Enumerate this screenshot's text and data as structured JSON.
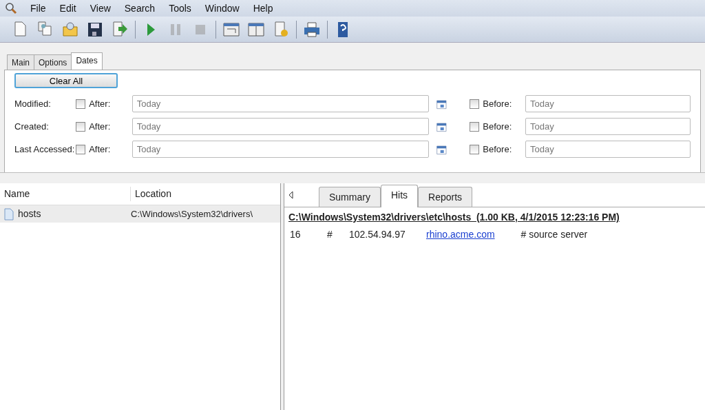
{
  "menu": [
    "File",
    "Edit",
    "View",
    "Search",
    "Tools",
    "Window",
    "Help"
  ],
  "toolbar": [
    [
      {
        "kind": "new",
        "disabled": false
      },
      {
        "kind": "copy",
        "disabled": false
      },
      {
        "kind": "open",
        "disabled": false
      },
      {
        "kind": "save",
        "disabled": false
      },
      {
        "kind": "export",
        "disabled": false
      }
    ],
    [
      {
        "kind": "play",
        "disabled": false
      },
      {
        "kind": "pause",
        "disabled": true
      },
      {
        "kind": "stop",
        "disabled": true
      }
    ],
    [
      {
        "kind": "window",
        "disabled": false
      },
      {
        "kind": "layout",
        "disabled": false
      },
      {
        "kind": "report",
        "disabled": false
      }
    ],
    [
      {
        "kind": "print",
        "disabled": false
      }
    ],
    [
      {
        "kind": "help",
        "disabled": false
      }
    ]
  ],
  "search_tabs": [
    {
      "label": "Main",
      "selected": false
    },
    {
      "label": "Options",
      "selected": false
    },
    {
      "label": "Dates",
      "selected": true
    }
  ],
  "clear_button": "Clear All",
  "date_rows": [
    {
      "label": "Modified:",
      "after": {
        "label": "After:",
        "checked": false,
        "value": "Today",
        "disabled": true
      },
      "before": {
        "label": "Before:",
        "checked": false,
        "value": "Today",
        "disabled": true
      }
    },
    {
      "label": "Created:",
      "after": {
        "label": "After:",
        "checked": false,
        "value": "Today",
        "disabled": true
      },
      "before": {
        "label": "Before:",
        "checked": false,
        "value": "Today",
        "disabled": true
      }
    },
    {
      "label": "Last Accessed:",
      "after": {
        "label": "After:",
        "checked": false,
        "value": "Today",
        "disabled": true
      },
      "before": {
        "label": "Before:",
        "checked": false,
        "value": "Today",
        "disabled": true
      }
    }
  ],
  "file_list": {
    "columns": [
      "Name",
      "Location"
    ],
    "rows": [
      {
        "name": "hosts",
        "location": "C:\\Windows\\System32\\drivers\\",
        "selected": true
      }
    ]
  },
  "result_tabs": [
    {
      "label": "Summary",
      "selected": false
    },
    {
      "label": "Hits",
      "selected": true
    },
    {
      "label": "Reports",
      "selected": false
    }
  ],
  "hits": {
    "header": "C:\\Windows\\System32\\drivers\\etc\\hosts  (1.00 KB, 4/1/2015 12:23:16 PM)",
    "lines": [
      {
        "line": "16",
        "hash": "#",
        "ip": "102.54.94.97",
        "host": "rhino.acme.com",
        "comment": "# source server"
      }
    ]
  }
}
